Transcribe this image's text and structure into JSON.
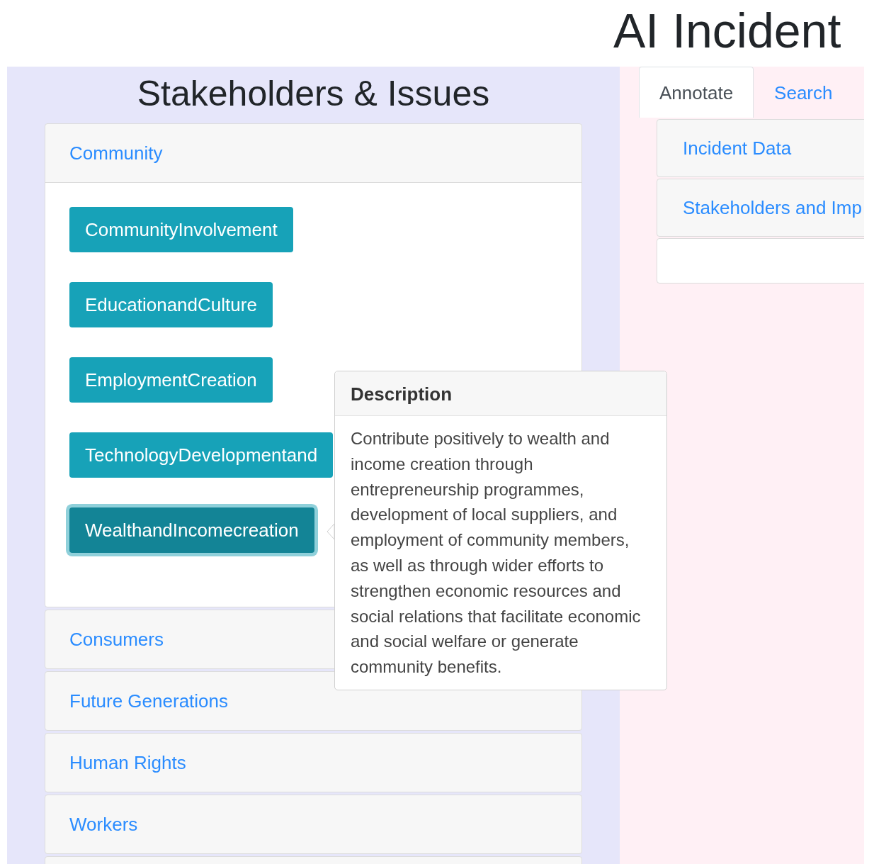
{
  "page_title": "AI Incident",
  "stakeholders_panel": {
    "heading": "Stakeholders & Issues",
    "groups": [
      {
        "label": "Community",
        "expanded": true,
        "issues": [
          {
            "label": "CommunityInvolvement",
            "selected": false
          },
          {
            "label": "EducationandCulture",
            "selected": false
          },
          {
            "label": "EmploymentCreation",
            "selected": false
          },
          {
            "label": "TechnologyDevelopmentand",
            "selected": false
          },
          {
            "label": "WealthandIncomecreation",
            "selected": true
          }
        ]
      },
      {
        "label": "Consumers",
        "expanded": false
      },
      {
        "label": "Future Generations",
        "expanded": false
      },
      {
        "label": "Human Rights",
        "expanded": false
      },
      {
        "label": "Workers",
        "expanded": false
      }
    ]
  },
  "popover": {
    "title": "Description",
    "text": "Contribute positively to wealth and income creation through entrepreneurship programmes, development of local suppliers, and employment of community members, as well as through wider efforts to strengthen economic resources and social relations that facilitate economic and social welfare or generate community benefits."
  },
  "tabs": [
    {
      "label": "Annotate",
      "selected": true
    },
    {
      "label": "Search",
      "selected": false
    }
  ],
  "sections": [
    {
      "label": "Incident Data"
    },
    {
      "label": "Stakeholders and Imp"
    }
  ]
}
